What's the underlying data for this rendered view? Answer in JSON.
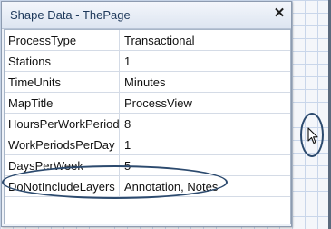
{
  "panel": {
    "title": "Shape Data - ThePage",
    "close_glyph": "✕"
  },
  "properties": [
    {
      "key": "ProcessType",
      "value": "Transactional"
    },
    {
      "key": "Stations",
      "value": "1"
    },
    {
      "key": "TimeUnits",
      "value": "Minutes"
    },
    {
      "key": "MapTitle",
      "value": "ProcessView"
    },
    {
      "key": "HoursPerWorkPeriod",
      "value": "8"
    },
    {
      "key": "WorkPeriodsPerDay",
      "value": "1"
    },
    {
      "key": "DaysPerWeek",
      "value": "5"
    },
    {
      "key": "DoNotIncludeLayers",
      "value": "Annotation, Notes"
    }
  ],
  "icons": {
    "close": "close-icon",
    "cursor": "mouse-pointer-icon"
  },
  "colors": {
    "annotation_ellipse": "#2c4a6e",
    "title_text": "#1e395b",
    "grid_line": "#c9d6ea"
  }
}
